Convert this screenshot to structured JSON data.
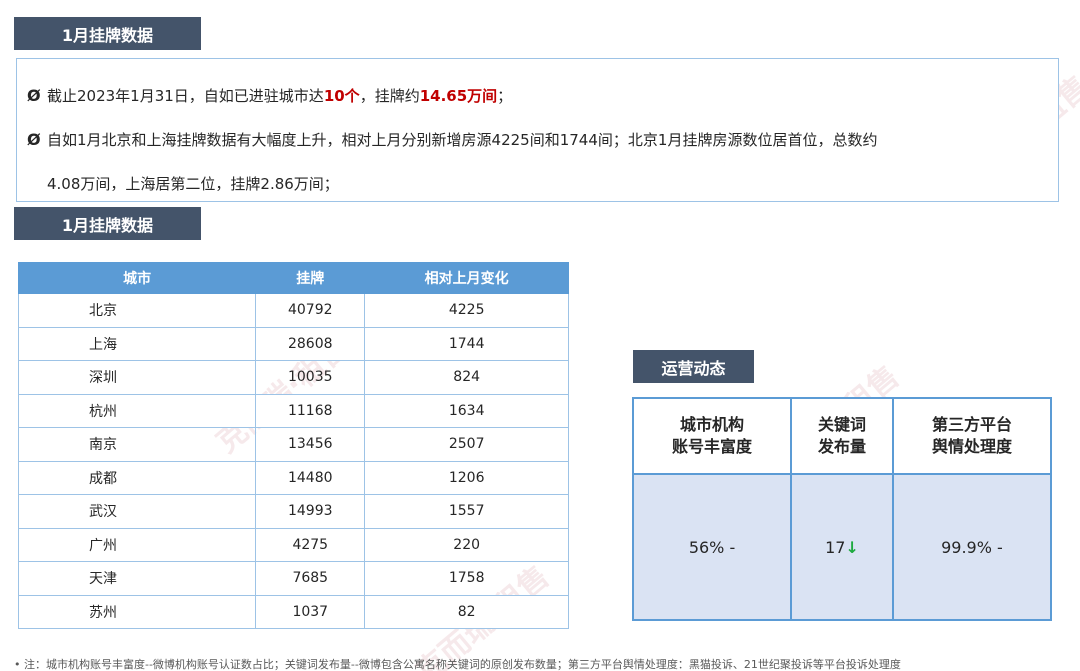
{
  "tags": {
    "top": "1月挂牌数据",
    "middle": "1月挂牌数据",
    "ops": "运营动态"
  },
  "summary": {
    "bullet_icon": "Ø",
    "line1_pre": "截止2023年1月31日，自如已进驻城市达",
    "line1_cities": "10个",
    "line1_mid": "，挂牌约",
    "line1_listings": "14.65万间",
    "line1_end": "；",
    "line2": "自如1月北京和上海挂牌数据有大幅度上升，相对上月分别新增房源4225间和1744间；北京1月挂牌房源数位居首位，总数约",
    "line3": "4.08万间，上海居第二位，挂牌2.86万间；"
  },
  "table": {
    "headers": [
      "城市",
      "挂牌",
      "相对上月变化"
    ],
    "rows": [
      {
        "city": "北京",
        "listings": "40792",
        "change": "4225"
      },
      {
        "city": "上海",
        "listings": "28608",
        "change": "1744"
      },
      {
        "city": "深圳",
        "listings": "10035",
        "change": "824"
      },
      {
        "city": "杭州",
        "listings": "11168",
        "change": "1634"
      },
      {
        "city": "南京",
        "listings": "13456",
        "change": "2507"
      },
      {
        "city": "成都",
        "listings": "14480",
        "change": "1206"
      },
      {
        "city": "武汉",
        "listings": "14993",
        "change": "1557"
      },
      {
        "city": "广州",
        "listings": "4275",
        "change": "220"
      },
      {
        "city": "天津",
        "listings": "7685",
        "change": "1758"
      },
      {
        "city": "苏州",
        "listings": "1037",
        "change": "82"
      }
    ]
  },
  "ops": {
    "headers": [
      {
        "line1": "城市机构",
        "line2": "账号丰富度"
      },
      {
        "line1": "关键词",
        "line2": "发布量"
      },
      {
        "line1": "第三方平台",
        "line2": "舆情处理度"
      }
    ],
    "values": [
      {
        "value": "56%",
        "trend": "-"
      },
      {
        "value": "17",
        "trend": "↓"
      },
      {
        "value": "99.9%",
        "trend": "-"
      }
    ]
  },
  "footnote": "•   注：城市机构账号丰富度--微博机构账号认证数占比；关键词发布量--微博包含公寓名称关键词的原创发布数量；第三方平台舆情处理度：黑猫投诉、21世纪聚投诉等平台投诉处理度",
  "watermark_text": "克而瑞·租售",
  "colors": {
    "tag_bg": "#44546a",
    "header_blue": "#5b9bd5",
    "cell_light_blue": "#dae3f3",
    "highlight_red": "#c00000",
    "down_arrow_green": "#1daa3f"
  }
}
